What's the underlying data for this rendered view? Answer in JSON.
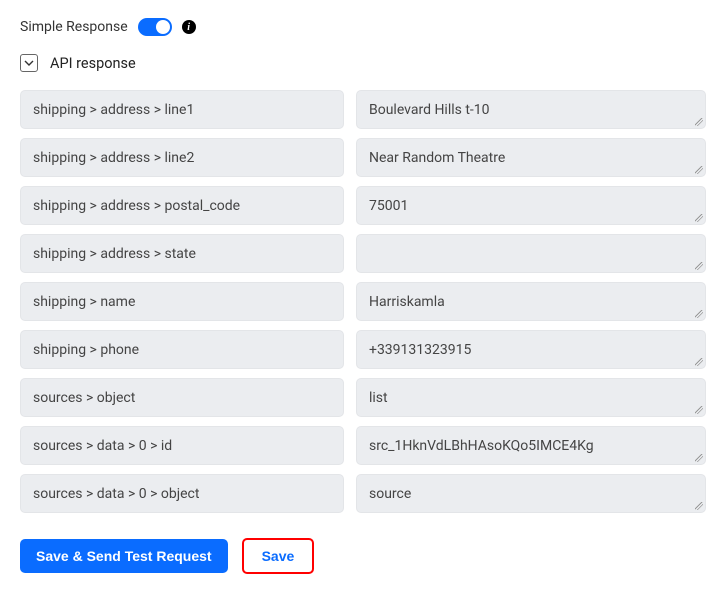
{
  "header": {
    "title": "Simple Response",
    "toggle_on": true
  },
  "section": {
    "label": "API response"
  },
  "fields": [
    {
      "key": "shipping > address > line1",
      "value": "Boulevard Hills t-10"
    },
    {
      "key": "shipping > address > line2",
      "value": "Near Random Theatre"
    },
    {
      "key": "shipping > address > postal_code",
      "value": "75001"
    },
    {
      "key": "shipping > address > state",
      "value": ""
    },
    {
      "key": "shipping > name",
      "value": "Harriskamla"
    },
    {
      "key": "shipping > phone",
      "value": "+339131323915"
    },
    {
      "key": "sources > object",
      "value": "list"
    },
    {
      "key": "sources > data > 0 > id",
      "value": "src_1HknVdLBhHAsoKQo5IMCE4Kg"
    },
    {
      "key": "sources > data > 0 > object",
      "value": "source"
    },
    {
      "key": "",
      "value": ""
    }
  ],
  "footer": {
    "primary": "Save & Send Test Request",
    "secondary": "Save"
  }
}
